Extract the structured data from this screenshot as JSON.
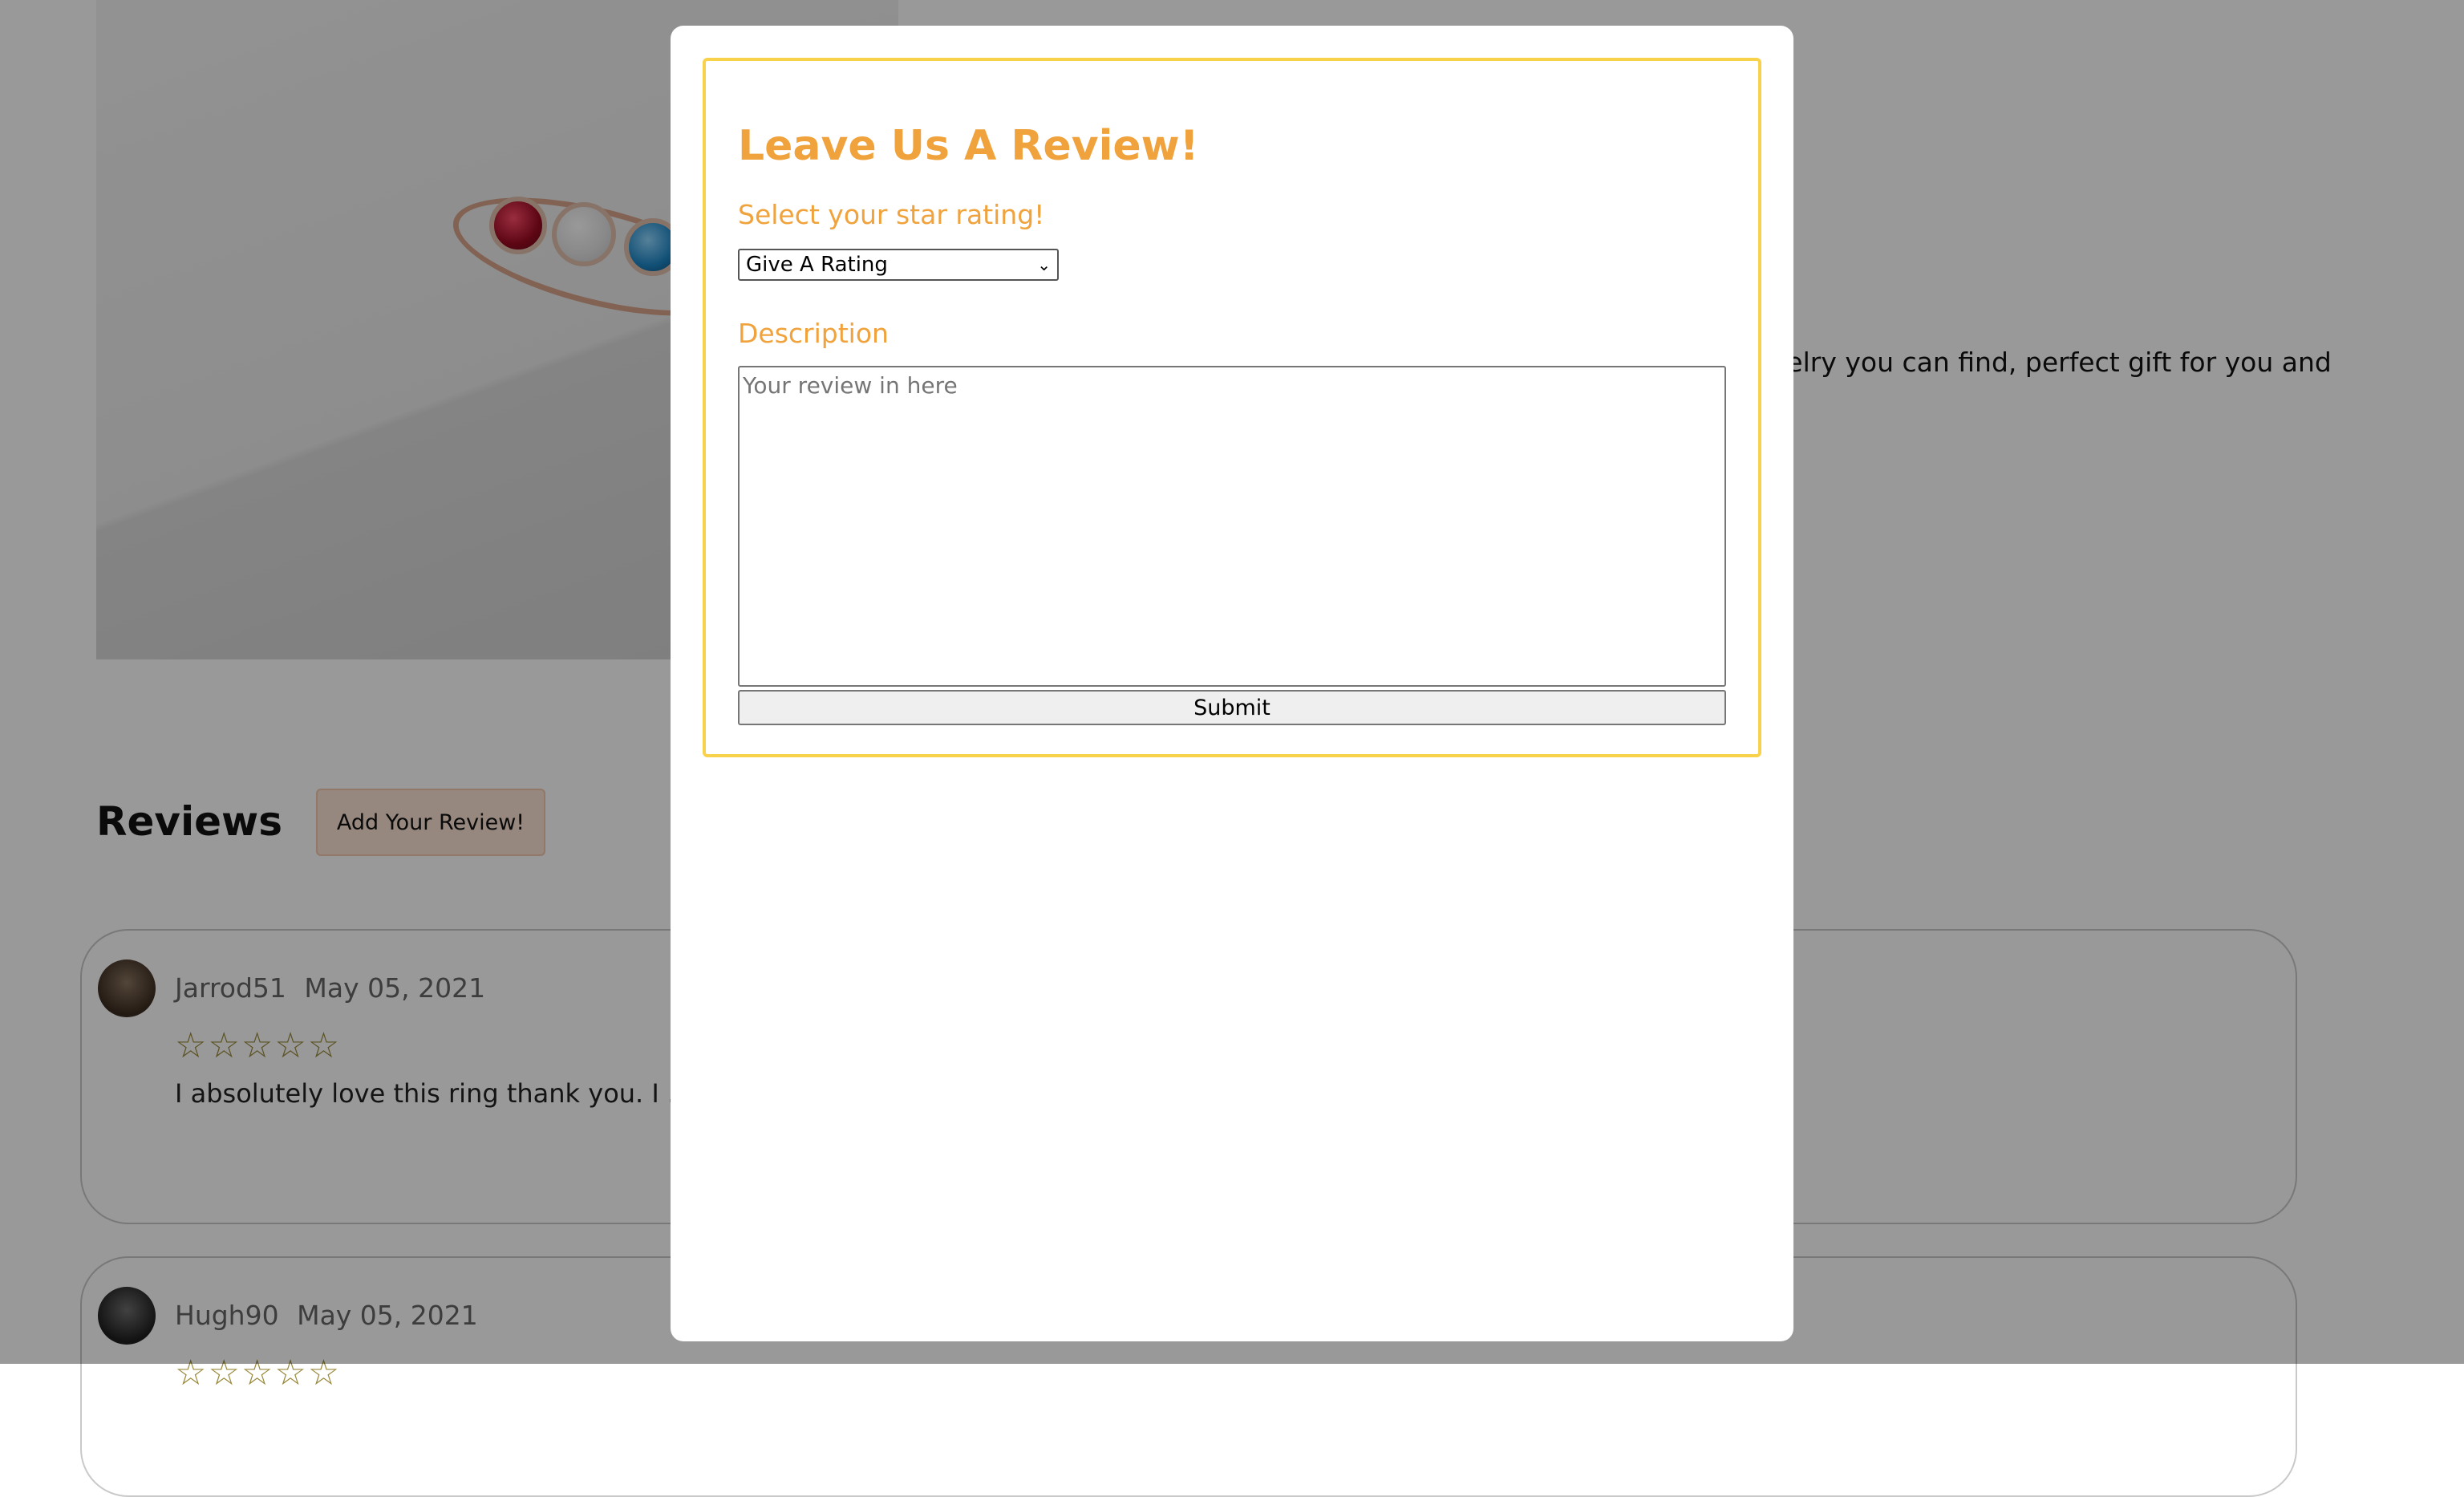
{
  "product": {
    "description_fragment": "ewelry you can find, perfect gift for you and"
  },
  "reviews_section": {
    "heading": "Reviews",
    "add_button_label": "Add Your Review!",
    "items": [
      {
        "author": "Jarrod51",
        "date": "May 05, 2021",
        "stars": "☆☆☆☆☆",
        "text": "I absolutely love this ring thank you. I … with the diamond in the center for them then the girls on either side"
      },
      {
        "author": "Hugh90",
        "date": "May 05, 2021",
        "stars": "☆☆☆☆☆",
        "text": ""
      }
    ]
  },
  "modal": {
    "title": "Leave Us A Review!",
    "rating_label": "Select your star rating!",
    "rating_selected": "Give A Rating",
    "description_label": "Description",
    "textarea_placeholder": "Your review in here",
    "submit_label": "Submit"
  },
  "colors": {
    "accent": "#f0a33c",
    "form_border": "#f7d24a",
    "overlay": "rgba(0,0,0,0.4)"
  },
  "icons": {
    "select_chevron": "chevron-down-icon",
    "star": "star-outline-icon"
  }
}
